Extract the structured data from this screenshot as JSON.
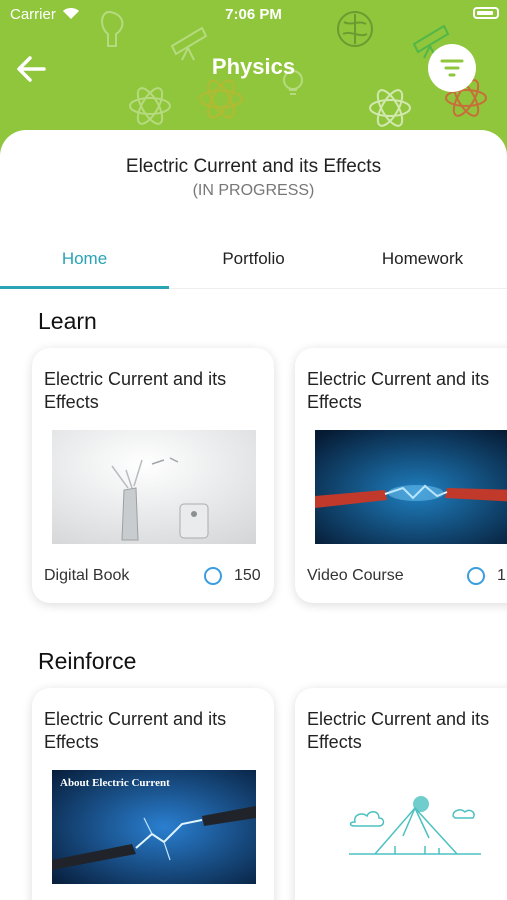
{
  "status_bar": {
    "carrier": "Carrier",
    "time": "7:06 PM"
  },
  "header": {
    "title": "Physics",
    "back_icon": "arrow-left-icon",
    "filter_icon": "filter-icon"
  },
  "topic": {
    "name": "Electric Current and its Effects",
    "status": "(IN PROGRESS)"
  },
  "tabs": [
    {
      "label": "Home",
      "active": true
    },
    {
      "label": "Portfolio"
    },
    {
      "label": "Homework"
    }
  ],
  "learn": {
    "heading": "Learn",
    "cards": [
      {
        "title": "Electric Current and its Effects",
        "type": "Digital Book",
        "count": "150"
      },
      {
        "title": "Electric Current and its Effects",
        "type": "Video Course",
        "count": "1"
      }
    ]
  },
  "reinforce": {
    "heading": "Reinforce",
    "cards": [
      {
        "title": "Electric Current and its Effects",
        "thumb_caption": "About Electric Current"
      },
      {
        "title": "Electric Current and its Effects"
      }
    ]
  },
  "colors": {
    "header_green": "#8fc63b",
    "accent": "#2aa3b5",
    "ring_blue": "#3a9de0"
  }
}
